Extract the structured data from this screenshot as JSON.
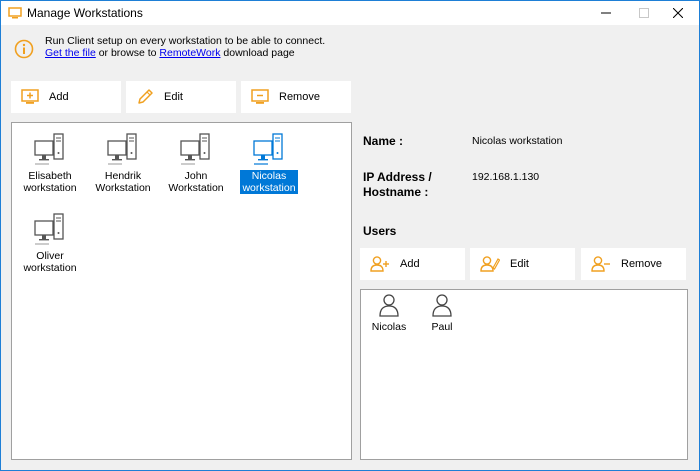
{
  "window": {
    "title": "Manage Workstations",
    "minimize_glyph": "—",
    "close_glyph": "✕"
  },
  "info": {
    "line1": "Run Client setup on every workstation to be able to connect.",
    "get_file_link": "Get the file",
    "middle_text": " or browse to ",
    "remotework_link": "RemoteWork",
    "end_text": " download page"
  },
  "toolbar": {
    "add_label": "Add",
    "edit_label": "Edit",
    "remove_label": "Remove"
  },
  "workstations": [
    {
      "line1": "Elisabeth",
      "line2": "workstation",
      "selected": false
    },
    {
      "line1": "Hendrik",
      "line2": "Workstation",
      "selected": false
    },
    {
      "line1": "John",
      "line2": "Workstation",
      "selected": false
    },
    {
      "line1": "Nicolas",
      "line2": "workstation",
      "selected": true
    },
    {
      "line1": "Oliver",
      "line2": "workstation",
      "selected": false
    }
  ],
  "details": {
    "name_label": "Name :",
    "name_value": "Nicolas workstation",
    "ip_label_line1": "IP Address /",
    "ip_label_line2": "Hostname :",
    "ip_value": "192.168.1.130",
    "users_label": "Users"
  },
  "user_toolbar": {
    "add_label": "Add",
    "edit_label": "Edit",
    "remove_label": "Remove"
  },
  "users": [
    "Nicolas",
    "Paul"
  ],
  "colors": {
    "accent_orange": "#f0a020",
    "selection_blue": "#0078d7",
    "window_border": "#1e7fd6"
  },
  "icons": {
    "app": "monitor-icon",
    "info": "info-circle-icon",
    "add": "add-monitor-icon",
    "edit": "pencil-icon",
    "remove": "remove-monitor-icon",
    "workstation": "desktop-computer-icon",
    "user_add": "user-add-icon",
    "user_edit": "user-edit-icon",
    "user_remove": "user-remove-icon",
    "user": "person-icon"
  }
}
